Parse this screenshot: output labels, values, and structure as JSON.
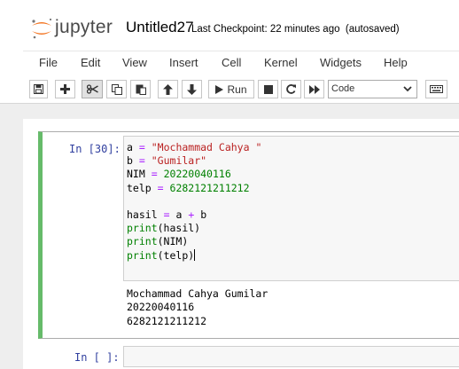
{
  "header": {
    "brand": "jupyter",
    "notebook_title": "Untitled27",
    "checkpoint_text": "Last Checkpoint: 22 minutes ago",
    "autosave_status": "(autosaved)",
    "colors": {
      "logo_orange": "#f37726",
      "logo_gray": "#767677"
    }
  },
  "menu": {
    "items": [
      "File",
      "Edit",
      "View",
      "Insert",
      "Cell",
      "Kernel",
      "Widgets",
      "Help"
    ]
  },
  "toolbar": {
    "icons": [
      "save-icon",
      "plus-icon",
      "cut-icon",
      "copy-icon",
      "paste-icon",
      "arrow-up-icon",
      "arrow-down-icon",
      "play-icon",
      "stop-icon",
      "restart-icon",
      "fast-forward-icon",
      "keyboard-icon"
    ],
    "run_label": "Run",
    "cell_type_selected": "Code"
  },
  "cells": [
    {
      "prompt": "In [30]:",
      "code_lines": [
        "a = \"Mochammad Cahya \"",
        "b = \"Gumilar\"",
        "NIM = 20220040116",
        "telp = 6282121211212",
        "",
        "hasil = a + b",
        "print(hasil)",
        "print(NIM)",
        "print(telp)"
      ],
      "output_lines": [
        "Mochammad Cahya Gumilar",
        "20220040116",
        "6282121211212"
      ]
    },
    {
      "prompt": "In [ ]:"
    }
  ],
  "code": {
    "l1": {
      "var": "a",
      "op": "=",
      "str": "\"Mochammad Cahya \""
    },
    "l2": {
      "var": "b",
      "op": "=",
      "str": "\"Gumilar\""
    },
    "l3": {
      "var": "NIM",
      "op": "=",
      "num": "20220040116"
    },
    "l4": {
      "var": "telp",
      "op": "=",
      "num": "6282121211212"
    },
    "l6": {
      "var": "hasil",
      "op": "=",
      "a": "a",
      "plus": "+",
      "b": "b"
    },
    "l7": {
      "fn": "print",
      "arg": "(hasil)"
    },
    "l8": {
      "fn": "print",
      "arg": "(NIM)"
    },
    "l9": {
      "fn": "print",
      "arg": "(telp)"
    }
  },
  "accent": {
    "selected_cell_border": "#66bb6a",
    "prompt_color": "#303f9f"
  }
}
